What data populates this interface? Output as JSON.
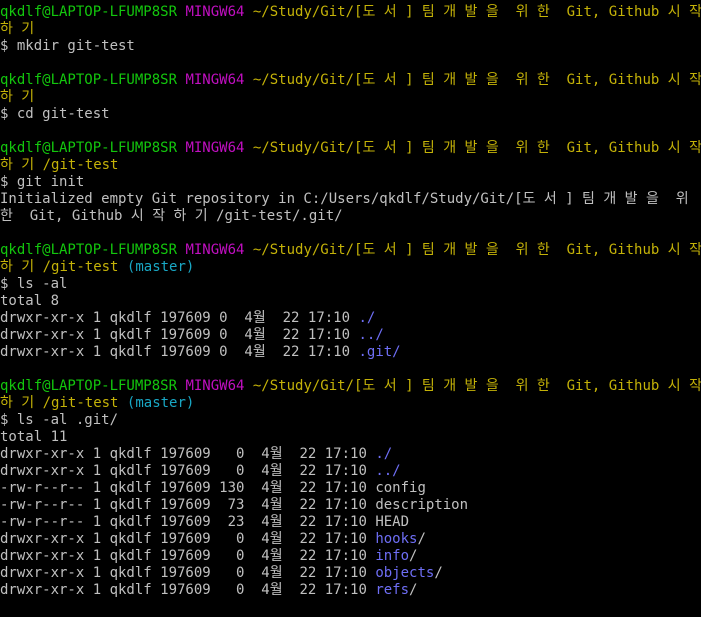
{
  "colors": {
    "background": "#000000",
    "user_host": "#13c70d",
    "mingw": "#c10fc1",
    "path": "#c4b208",
    "branch": "#19a7c4",
    "text": "#c0c0c0",
    "dir": "#6e6ef5"
  },
  "terminal": {
    "lines": [
      {
        "segs": [
          {
            "t": "qkdlf@LAPTOP-LFUMP8SR ",
            "c": "g"
          },
          {
            "t": "MINGW64 ",
            "c": "m"
          },
          {
            "t": "~/Study/Git/[도 서 ] 팀 개 발 을  위 한  Git, Github 시 작",
            "c": "y"
          }
        ]
      },
      {
        "segs": [
          {
            "t": "하 기",
            "c": "y"
          }
        ]
      },
      {
        "segs": [
          {
            "t": "$ mkdir git-test",
            "c": "w"
          }
        ]
      },
      {
        "segs": [
          {
            "t": "",
            "c": "w"
          }
        ]
      },
      {
        "segs": [
          {
            "t": "qkdlf@LAPTOP-LFUMP8SR ",
            "c": "g"
          },
          {
            "t": "MINGW64 ",
            "c": "m"
          },
          {
            "t": "~/Study/Git/[도 서 ] 팀 개 발 을  위 한  Git, Github 시 작",
            "c": "y"
          }
        ]
      },
      {
        "segs": [
          {
            "t": "하 기",
            "c": "y"
          }
        ]
      },
      {
        "segs": [
          {
            "t": "$ cd git-test",
            "c": "w"
          }
        ]
      },
      {
        "segs": [
          {
            "t": "",
            "c": "w"
          }
        ]
      },
      {
        "segs": [
          {
            "t": "qkdlf@LAPTOP-LFUMP8SR ",
            "c": "g"
          },
          {
            "t": "MINGW64 ",
            "c": "m"
          },
          {
            "t": "~/Study/Git/[도 서 ] 팀 개 발 을  위 한  Git, Github 시 작",
            "c": "y"
          }
        ]
      },
      {
        "segs": [
          {
            "t": "하 기 /git-test",
            "c": "y"
          }
        ]
      },
      {
        "segs": [
          {
            "t": "$ git init",
            "c": "w"
          }
        ]
      },
      {
        "segs": [
          {
            "t": "Initialized empty Git repository in C:/Users/qkdlf/Study/Git/[도 서 ] 팀 개 발 을  위",
            "c": "w"
          }
        ]
      },
      {
        "segs": [
          {
            "t": "한  Git, Github 시 작 하 기 /git-test/.git/",
            "c": "w"
          }
        ]
      },
      {
        "segs": [
          {
            "t": "",
            "c": "w"
          }
        ]
      },
      {
        "segs": [
          {
            "t": "qkdlf@LAPTOP-LFUMP8SR ",
            "c": "g"
          },
          {
            "t": "MINGW64 ",
            "c": "m"
          },
          {
            "t": "~/Study/Git/[도 서 ] 팀 개 발 을  위 한  Git, Github 시 작",
            "c": "y"
          }
        ]
      },
      {
        "segs": [
          {
            "t": "하 기 /git-test ",
            "c": "y"
          },
          {
            "t": "(master)",
            "c": "c"
          }
        ]
      },
      {
        "segs": [
          {
            "t": "$ ls -al",
            "c": "w"
          }
        ]
      },
      {
        "segs": [
          {
            "t": "total 8",
            "c": "w"
          }
        ]
      },
      {
        "segs": [
          {
            "t": "drwxr-xr-x 1 qkdlf 197609 0  4월  22 17:10 ",
            "c": "w"
          },
          {
            "t": "./",
            "c": "b"
          }
        ]
      },
      {
        "segs": [
          {
            "t": "drwxr-xr-x 1 qkdlf 197609 0  4월  22 17:10 ",
            "c": "w"
          },
          {
            "t": "../",
            "c": "b"
          }
        ]
      },
      {
        "segs": [
          {
            "t": "drwxr-xr-x 1 qkdlf 197609 0  4월  22 17:10 ",
            "c": "w"
          },
          {
            "t": ".git/",
            "c": "b"
          }
        ]
      },
      {
        "segs": [
          {
            "t": "",
            "c": "w"
          }
        ]
      },
      {
        "segs": [
          {
            "t": "qkdlf@LAPTOP-LFUMP8SR ",
            "c": "g"
          },
          {
            "t": "MINGW64 ",
            "c": "m"
          },
          {
            "t": "~/Study/Git/[도 서 ] 팀 개 발 을  위 한  Git, Github 시 작",
            "c": "y"
          }
        ]
      },
      {
        "segs": [
          {
            "t": "하 기 /git-test ",
            "c": "y"
          },
          {
            "t": "(master)",
            "c": "c"
          }
        ]
      },
      {
        "segs": [
          {
            "t": "$ ls -al .git/",
            "c": "w"
          }
        ]
      },
      {
        "segs": [
          {
            "t": "total 11",
            "c": "w"
          }
        ]
      },
      {
        "segs": [
          {
            "t": "drwxr-xr-x 1 qkdlf 197609   0  4월  22 17:10 ",
            "c": "w"
          },
          {
            "t": "./",
            "c": "b"
          }
        ]
      },
      {
        "segs": [
          {
            "t": "drwxr-xr-x 1 qkdlf 197609   0  4월  22 17:10 ",
            "c": "w"
          },
          {
            "t": "../",
            "c": "b"
          }
        ]
      },
      {
        "segs": [
          {
            "t": "-rw-r--r-- 1 qkdlf 197609 130  4월  22 17:10 config",
            "c": "w"
          }
        ]
      },
      {
        "segs": [
          {
            "t": "-rw-r--r-- 1 qkdlf 197609  73  4월  22 17:10 description",
            "c": "w"
          }
        ]
      },
      {
        "segs": [
          {
            "t": "-rw-r--r-- 1 qkdlf 197609  23  4월  22 17:10 HEAD",
            "c": "w"
          }
        ]
      },
      {
        "segs": [
          {
            "t": "drwxr-xr-x 1 qkdlf 197609   0  4월  22 17:10 ",
            "c": "w"
          },
          {
            "t": "hooks",
            "c": "b"
          },
          {
            "t": "/",
            "c": "w"
          }
        ]
      },
      {
        "segs": [
          {
            "t": "drwxr-xr-x 1 qkdlf 197609   0  4월  22 17:10 ",
            "c": "w"
          },
          {
            "t": "info",
            "c": "b"
          },
          {
            "t": "/",
            "c": "w"
          }
        ]
      },
      {
        "segs": [
          {
            "t": "drwxr-xr-x 1 qkdlf 197609   0  4월  22 17:10 ",
            "c": "w"
          },
          {
            "t": "objects",
            "c": "b"
          },
          {
            "t": "/",
            "c": "w"
          }
        ]
      },
      {
        "segs": [
          {
            "t": "drwxr-xr-x 1 qkdlf 197609   0  4월  22 17:10 ",
            "c": "w"
          },
          {
            "t": "refs",
            "c": "b"
          },
          {
            "t": "/",
            "c": "w"
          }
        ]
      }
    ]
  }
}
